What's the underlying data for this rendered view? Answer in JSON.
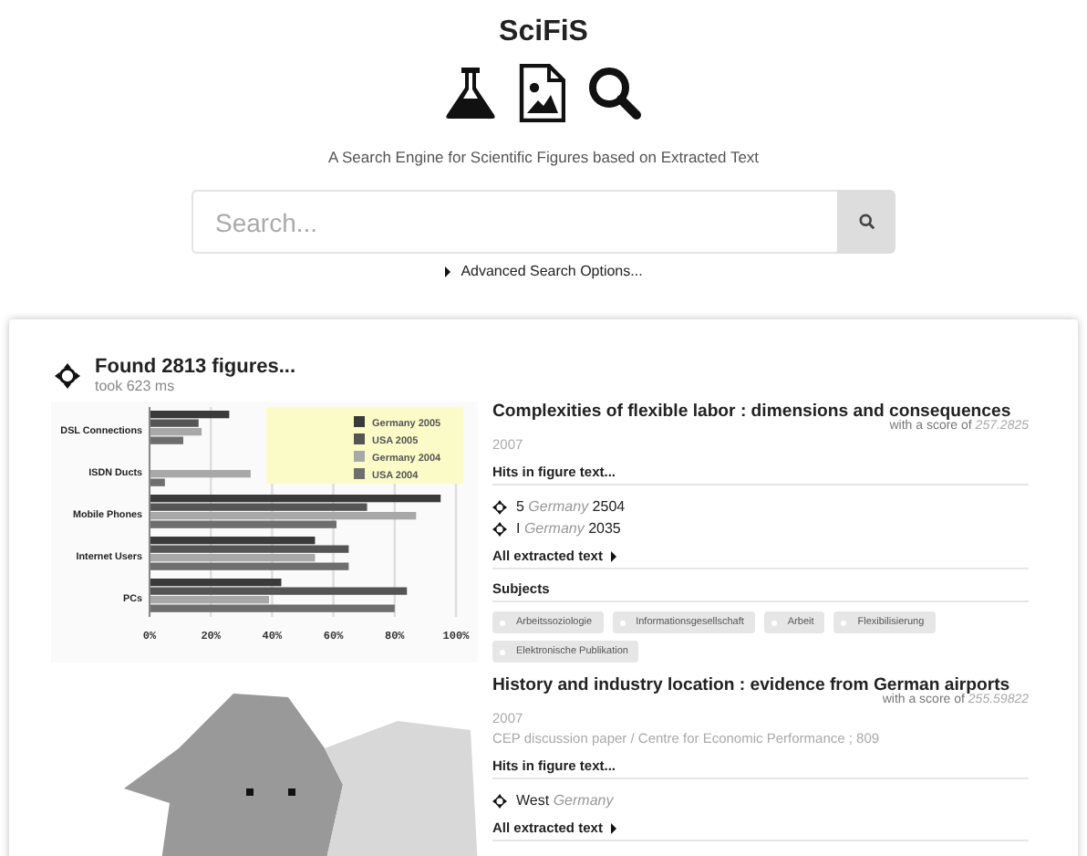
{
  "header": {
    "title": "SciFiS",
    "subtitle": "A Search Engine for Scientific Figures based on Extracted Text"
  },
  "search": {
    "placeholder": "Search...",
    "advanced_label": "Advanced Search Options..."
  },
  "results": {
    "found": "Found 2813 figures...",
    "took": "took 623 ms",
    "items": [
      {
        "figure": {
          "kind": "chart",
          "chart_data": {
            "type": "bar",
            "orientation": "horizontal",
            "categories": [
              "DSL Connections",
              "ISDN Ducts",
              "Mobile Phones",
              "Internet Users",
              "PCs"
            ],
            "series": [
              {
                "name": "Germany 2005",
                "color": "#3a3a3a",
                "values": [
                  26,
                  null,
                  95,
                  54,
                  43
                ]
              },
              {
                "name": "USA 2005",
                "color": "#555555",
                "values": [
                  16,
                  null,
                  71,
                  65,
                  84
                ]
              },
              {
                "name": "Germany 2004",
                "color": "#a8a8a8",
                "values": [
                  17,
                  33,
                  87,
                  54,
                  39
                ]
              },
              {
                "name": "USA 2004",
                "color": "#6e6e6e",
                "values": [
                  11,
                  5,
                  61,
                  65,
                  80
                ]
              }
            ],
            "grid": true,
            "legend": true,
            "xlim": [
              0,
              100
            ],
            "xticks": [
              {
                "value": 0,
                "label": "0%"
              },
              {
                "value": 20,
                "label": "20%"
              },
              {
                "value": 40,
                "label": "40%"
              },
              {
                "value": 60,
                "label": "60%"
              },
              {
                "value": 80,
                "label": "80%"
              },
              {
                "value": 100,
                "label": "100%"
              }
            ]
          }
        },
        "title": "Complexities of flexible labor : dimensions and consequences",
        "score_label": "with a score of",
        "score": "257.2825",
        "year": "2007",
        "hits_heading": "Hits in figure text...",
        "hits": [
          {
            "before": "5",
            "term": "Germany",
            "after": "2504"
          },
          {
            "before": "I",
            "term": "Germany",
            "after": "2035"
          }
        ],
        "all_text": "All extracted text",
        "subjects_heading": "Subjects",
        "subjects": [
          "Arbeitssoziologie",
          "Informationsgesellschaft",
          "Arbeit",
          "Flexibilisierung",
          "Elektronische Publikation"
        ]
      },
      {
        "figure": {
          "kind": "map"
        },
        "title": "History and industry location : evidence from German airports",
        "score_label": "with a score of",
        "score": "255.59822",
        "year": "2007",
        "series": "CEP discussion paper / Centre for Economic Performance ; 809",
        "hits_heading": "Hits in figure text...",
        "hits": [
          {
            "before": "West",
            "term": "Germany"
          }
        ],
        "all_text": "All extracted text"
      }
    ]
  }
}
